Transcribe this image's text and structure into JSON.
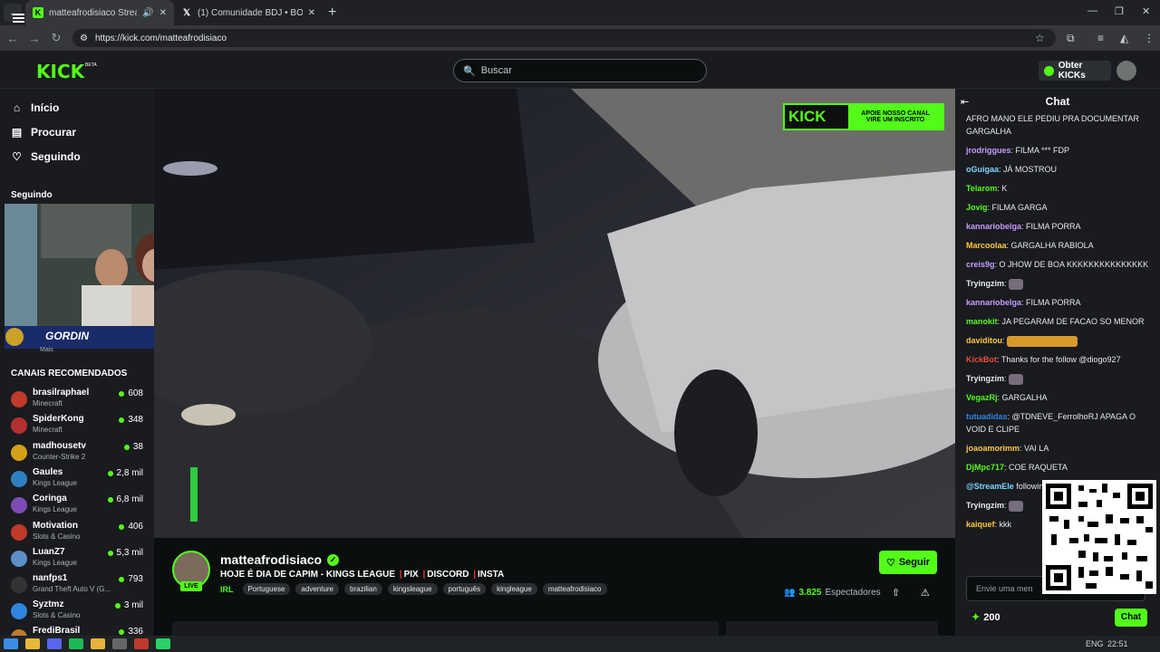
{
  "browser": {
    "tabs": [
      {
        "title": "matteafrodisiaco Stream - W",
        "active": true,
        "icon": "kick-favicon"
      },
      {
        "title": "(1) Comunidade BDJ • BONDE",
        "active": false,
        "icon": "x-favicon"
      }
    ],
    "url": "https://kick.com/matteafrodisiaco"
  },
  "nav": {
    "logo": "KICK",
    "beta": "BETA",
    "search_placeholder": "Buscar",
    "get_kicks": "Obter KICKs"
  },
  "sidebar": {
    "items": [
      {
        "label": "Início",
        "icon": "home-icon"
      },
      {
        "label": "Procurar",
        "icon": "browse-icon"
      },
      {
        "label": "Seguindo",
        "icon": "heart-icon"
      }
    ],
    "following_header": "Seguindo",
    "following_overlay": "GORDIN",
    "following_sub": "Mais",
    "recommended_header": "CANAIS RECOMENDADOS",
    "recommended": [
      {
        "name": "brasilraphael",
        "category": "Minecraft",
        "viewers": "608",
        "color": "#c0392b"
      },
      {
        "name": "SpiderKong",
        "category": "Minecraft",
        "viewers": "348",
        "color": "#b33030"
      },
      {
        "name": "madhousetv",
        "category": "Counter-Strike 2",
        "viewers": "38",
        "color": "#d4a017"
      },
      {
        "name": "Gaules",
        "category": "Kings League",
        "viewers": "2,8 mil",
        "color": "#2f80c0"
      },
      {
        "name": "Coringa",
        "category": "Kings League",
        "viewers": "6,8 mil",
        "color": "#7d4bb3"
      },
      {
        "name": "Motivation",
        "category": "Slots & Casino",
        "viewers": "406",
        "color": "#c0392b"
      },
      {
        "name": "LuanZ7",
        "category": "Kings League",
        "viewers": "5,3 mil",
        "color": "#5b8fc7"
      },
      {
        "name": "nanfps1",
        "category": "Grand Theft Auto V (G...",
        "viewers": "793",
        "color": "#222"
      },
      {
        "name": "Syztmz",
        "category": "Slots & Casino",
        "viewers": "3 mil",
        "color": "#2e86de"
      },
      {
        "name": "FrediBrasil",
        "category": "",
        "viewers": "336",
        "color": "#c07a30"
      }
    ]
  },
  "video": {
    "banner_logo": "KICK",
    "banner_line1": "APOIE NOSSO CANAL",
    "banner_line2": "VIRE UM INSCRITO"
  },
  "stream": {
    "channel": "matteafrodisiaco",
    "live": "LIVE",
    "title_parts": [
      "HOJE É DIA DE CAPIM - KINGS LEAGUE",
      "PIX",
      "DISCORD",
      "INSTA"
    ],
    "category": "IRL",
    "tags": [
      "Portuguese",
      "adventure",
      "brazilian",
      "kingsleague",
      "português",
      "kingleague",
      "matteafrodisiaco"
    ],
    "follow_label": "Seguir",
    "viewers_count": "3.825",
    "viewers_label": "Espectadores"
  },
  "chat": {
    "title": "Chat",
    "messages": [
      {
        "user": "",
        "text": "AFRO MANO ELE PEDIU PRA DOCUMENTAR GARGALHA",
        "color": "#e6e8ea"
      },
      {
        "user": "jrodriggues",
        "text": "FILMA *** FDP",
        "color": "#c79bff"
      },
      {
        "user": "oGuigaa",
        "text": "JÁ MOSTROU",
        "color": "#7fd6ff"
      },
      {
        "user": "Telarom",
        "text": "K",
        "color": "#53fc18"
      },
      {
        "user": "Jovig",
        "text": "FILMA GARGA",
        "color": "#53fc18"
      },
      {
        "user": "kannariobelga",
        "text": "FILMA PORRA",
        "color": "#c79bff"
      },
      {
        "user": "Marcoolaa",
        "text": "GARGALHA RABIOLA",
        "color": "#ffc83d"
      },
      {
        "user": "creis9g",
        "text": "O JHOW DE BOA KKKKKKKKKKKKKKK",
        "color": "#c79bff"
      },
      {
        "user": "Tryingzim",
        "text": "",
        "color": "#e6e8ea",
        "emote": true
      },
      {
        "user": "kannariobelga",
        "text": "FILMA PORRA",
        "color": "#c79bff"
      },
      {
        "user": "manokit",
        "text": "JA PEGARAM DE FACAO SO MENOR",
        "color": "#53fc18"
      },
      {
        "user": "daviditou",
        "text": "",
        "color": "#ffc83d",
        "emote": true
      },
      {
        "user": "KickBot",
        "text": "Thanks for the follow @diogo927",
        "color": "#e84c3d"
      },
      {
        "user": "Tryingzim",
        "text": "",
        "color": "#e6e8ea",
        "emote": true
      },
      {
        "user": "VegazRj",
        "text": "GARGALHA",
        "color": "#53fc18"
      },
      {
        "user": "tutuadidas",
        "text": "@TDNEVE_FerrolhoRJ APAGA O VOID E CLIPE",
        "color": "#2e86de"
      },
      {
        "user": "joaoamorimm",
        "text": "VAI LA",
        "color": "#ffc83d"
      },
      {
        "user": "DjMpc717",
        "text": "COE RAQUETA",
        "color": "#53fc18"
      },
      {
        "user": "@StreamEle",
        "text": "following diogo927",
        "color": "#7fd6ff"
      },
      {
        "user": "Tryingzim",
        "text": "",
        "color": "#e6e8ea",
        "emote": true
      },
      {
        "user": "kaiquef",
        "text": "kkk",
        "color": "#ffc83d"
      }
    ],
    "input_placeholder": "Envie uma men",
    "points": "200",
    "send_label": "Chat"
  },
  "taskbar": {
    "lang": "ENG",
    "time": "22:51"
  }
}
